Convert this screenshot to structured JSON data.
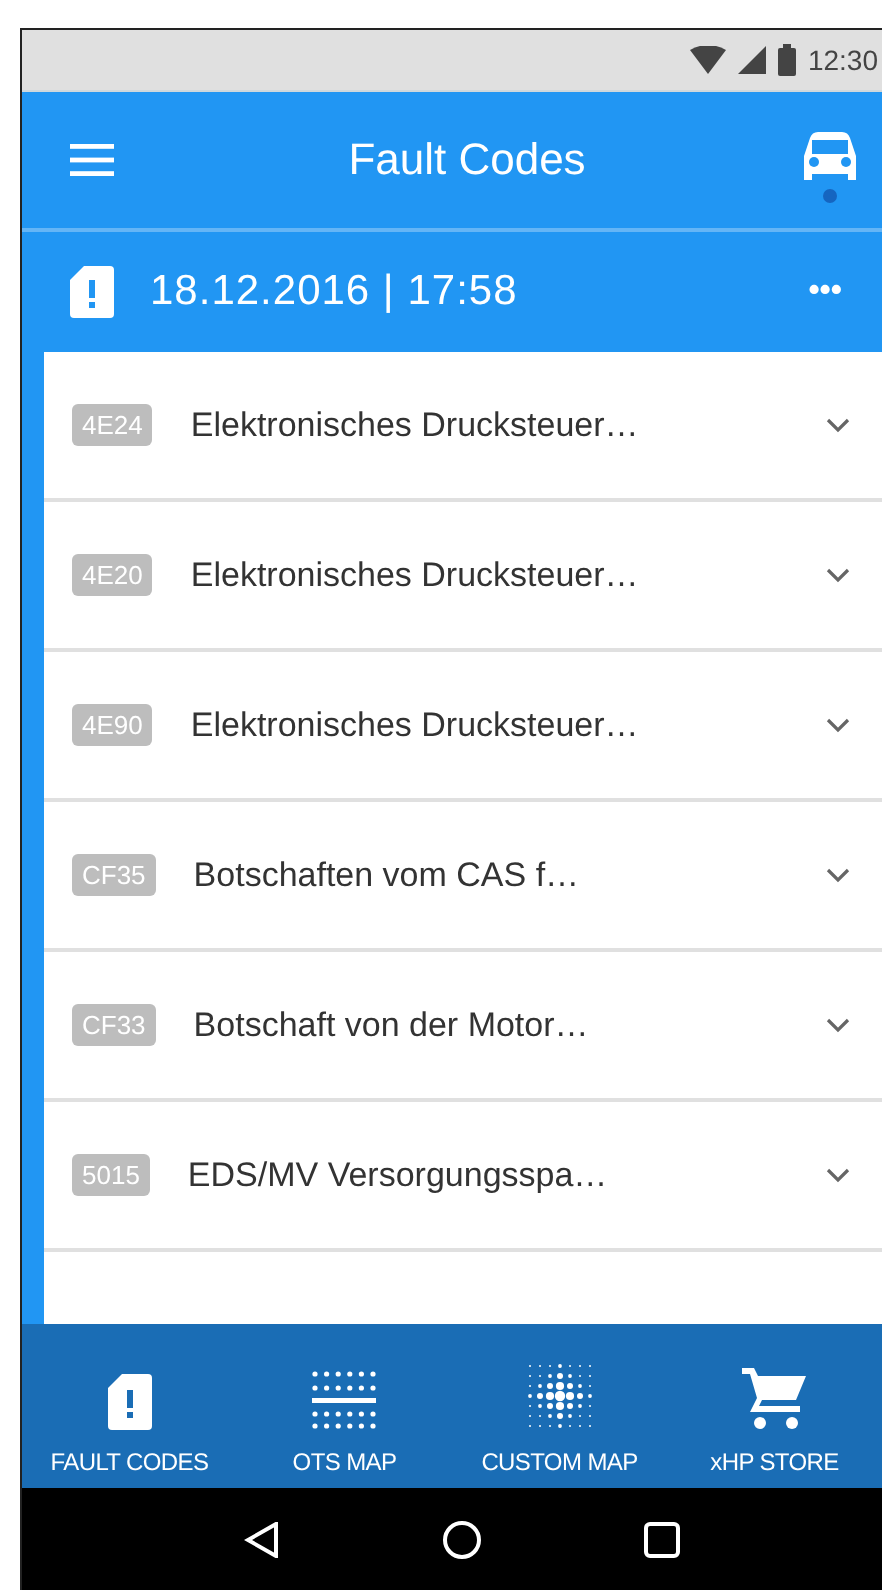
{
  "status_bar": {
    "time": "12:30"
  },
  "app_bar": {
    "title": "Fault Codes"
  },
  "session": {
    "timestamp": "18.12.2016 | 17:58",
    "menu": "•••"
  },
  "faults": [
    {
      "code": "4E24",
      "description": "Elektronisches Drucksteuer…"
    },
    {
      "code": "4E20",
      "description": "Elektronisches Drucksteuer…"
    },
    {
      "code": "4E90",
      "description": "Elektronisches Drucksteuer…"
    },
    {
      "code": "CF35",
      "description": "Botschaften vom CAS f…"
    },
    {
      "code": "CF33",
      "description": "Botschaft von der Motor…"
    },
    {
      "code": "5015",
      "description": "EDS/MV Versorgungsspa…"
    }
  ],
  "bottom_nav": [
    {
      "kind": "fault",
      "label": "FAULT CODES"
    },
    {
      "kind": "ots",
      "label": "OTS MAP"
    },
    {
      "kind": "custom",
      "label": "CUSTOM MAP"
    },
    {
      "kind": "store",
      "label": "xHP STORE"
    }
  ]
}
